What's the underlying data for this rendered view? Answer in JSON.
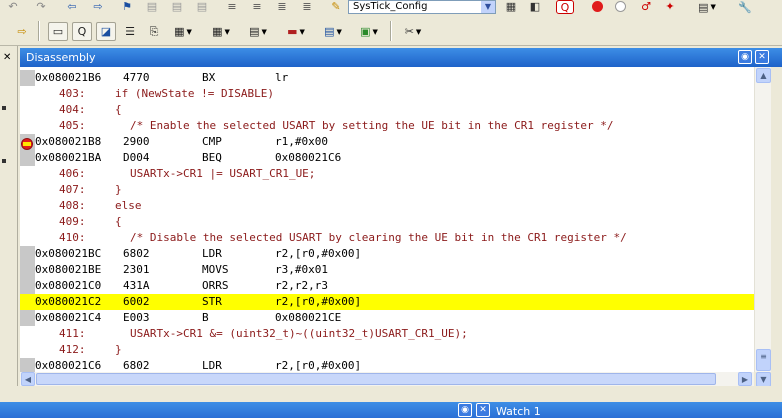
{
  "toolbar_top": {
    "target_combo": "SysTick_Config"
  },
  "window": {
    "title": "Disassembly"
  },
  "bottom": {
    "watch_tab": "Watch 1"
  },
  "disassembly": [
    {
      "kind": "asm",
      "addr": "0x080021B6",
      "code": "4770",
      "mnem": "BX",
      "ops": "lr"
    },
    {
      "kind": "src",
      "num": "403:",
      "text": "if (NewState != DISABLE)",
      "indent": 0
    },
    {
      "kind": "src",
      "num": "404:",
      "text": "{",
      "indent": 0
    },
    {
      "kind": "src",
      "num": "405:",
      "text": "/* Enable the selected USART by setting the UE bit in the CR1 register */",
      "indent": 2
    },
    {
      "kind": "asm",
      "addr": "0x080021B8",
      "code": "2900",
      "mnem": "CMP",
      "ops": "r1,#0x00"
    },
    {
      "kind": "asm",
      "addr": "0x080021BA",
      "code": "D004",
      "mnem": "BEQ",
      "ops": "0x080021C6"
    },
    {
      "kind": "src",
      "num": "406:",
      "text": "USARTx->CR1 |= USART_CR1_UE;",
      "indent": 2
    },
    {
      "kind": "src",
      "num": "407:",
      "text": "}",
      "indent": 0
    },
    {
      "kind": "src",
      "num": "408:",
      "text": "else",
      "indent": 0
    },
    {
      "kind": "src",
      "num": "409:",
      "text": "{",
      "indent": 0
    },
    {
      "kind": "src",
      "num": "410:",
      "text": "/* Disable the selected USART by clearing the UE bit in the CR1 register */",
      "indent": 2
    },
    {
      "kind": "asm",
      "addr": "0x080021BC",
      "code": "6802",
      "mnem": "LDR",
      "ops": "r2,[r0,#0x00]"
    },
    {
      "kind": "asm",
      "addr": "0x080021BE",
      "code": "2301",
      "mnem": "MOVS",
      "ops": "r3,#0x01"
    },
    {
      "kind": "asm",
      "addr": "0x080021C0",
      "code": "431A",
      "mnem": "ORRS",
      "ops": "r2,r2,r3"
    },
    {
      "kind": "asm",
      "addr": "0x080021C2",
      "code": "6002",
      "mnem": "STR",
      "ops": "r2,[r0,#0x00]",
      "current": true
    },
    {
      "kind": "asm",
      "addr": "0x080021C4",
      "code": "E003",
      "mnem": "B",
      "ops": "0x080021CE"
    },
    {
      "kind": "src",
      "num": "411:",
      "text": "USARTx->CR1 &= (uint32_t)~((uint32_t)USART_CR1_UE);",
      "indent": 2
    },
    {
      "kind": "src",
      "num": "412:",
      "text": "}",
      "indent": 0
    },
    {
      "kind": "asm",
      "addr": "0x080021C6",
      "code": "6802",
      "mnem": "LDR",
      "ops": "r2,[r0,#0x00]"
    }
  ],
  "colors": {
    "title_bar": "#2b74d8",
    "current_line": "#ffff00",
    "source_text": "#8b1a1a",
    "asm_text": "#000000",
    "breakpoint": "#e01b1b"
  }
}
